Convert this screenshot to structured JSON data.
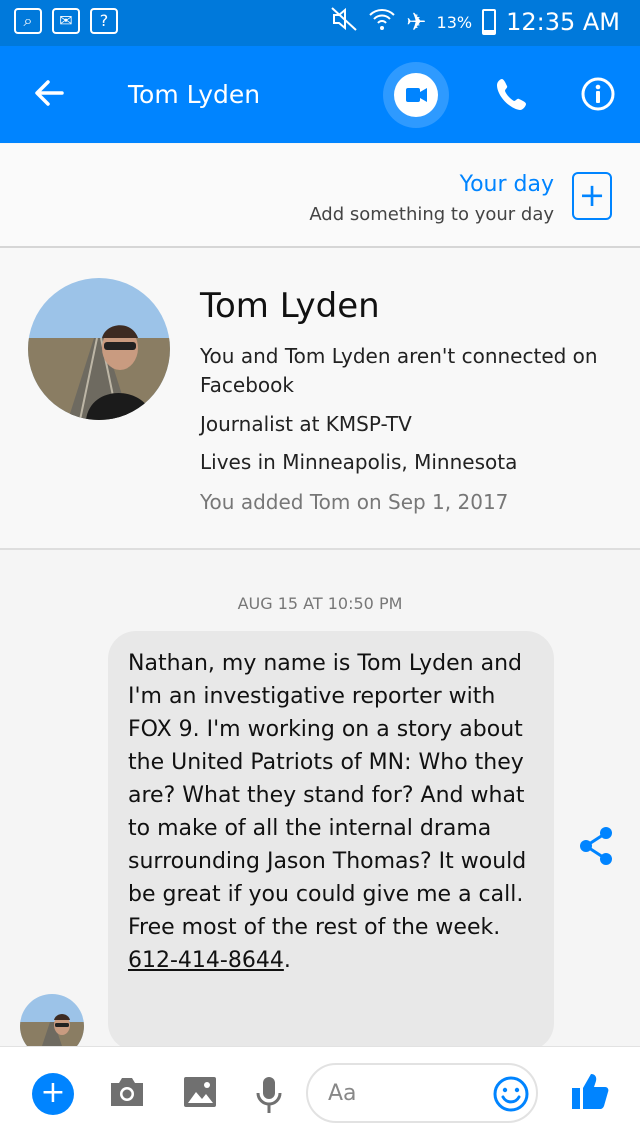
{
  "status_bar": {
    "battery": "13%",
    "time": "12:35 AM",
    "battery_level": 0.13
  },
  "header": {
    "title": "Tom Lyden"
  },
  "your_day": {
    "title": "Your day",
    "subtitle": "Add something to your day"
  },
  "profile": {
    "name": "Tom Lyden",
    "connection": "You and Tom Lyden aren't connected on Facebook",
    "job": "Journalist at KMSP-TV",
    "location": "Lives in Minneapolis, Minnesota",
    "added": "You added Tom on Sep 1, 2017"
  },
  "thread": {
    "timestamp": "AUG 15 AT 10:50 PM",
    "message": {
      "body": "Nathan, my name is Tom Lyden and I'm an investigative reporter with FOX 9. I'm working on a story about the United Patriots of MN: Who they are? What they stand for? And what to make of all the internal drama surrounding Jason Thomas? It would be great if you could give me a call. Free most of the rest of the week.",
      "phone": "612-414-8644",
      "end": "."
    }
  },
  "composer": {
    "placeholder": "Aa"
  },
  "colors": {
    "status_bar": "#0079db",
    "app_bar": "#0084ff",
    "accent": "#0084ff",
    "bubble": "#e8e8e8"
  }
}
